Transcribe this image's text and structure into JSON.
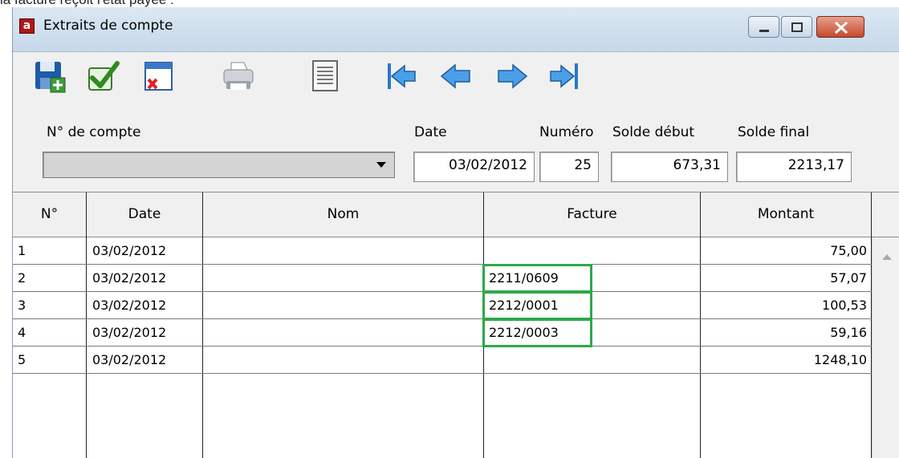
{
  "caption": "la facture reçoit l'état payée :",
  "window": {
    "title": "Extraits de compte",
    "app_icon_letter": "a",
    "accent": "#2fa84a"
  },
  "toolbar": {
    "buttons": [
      {
        "name": "save-new-icon"
      },
      {
        "name": "validate-check-icon"
      },
      {
        "name": "delete-window-icon"
      },
      {
        "name": "printer-icon"
      },
      {
        "name": "document-list-icon"
      },
      {
        "name": "first-record-icon"
      },
      {
        "name": "previous-record-icon"
      },
      {
        "name": "next-record-icon"
      },
      {
        "name": "last-record-icon"
      }
    ]
  },
  "form": {
    "account_label": "N° de compte",
    "account_value": "",
    "date_label": "Date",
    "date_value": "03/02/2012",
    "number_label": "Numéro",
    "number_value": "25",
    "start_balance_label": "Solde début",
    "start_balance_value": "673,31",
    "final_balance_label": "Solde final",
    "final_balance_value": "2213,17"
  },
  "table": {
    "columns": [
      "N°",
      "Date",
      "Nom",
      "Facture",
      "Montant"
    ],
    "rows": [
      {
        "n": "1",
        "date": "03/02/2012",
        "nom": "",
        "facture": "",
        "montant": "75,00"
      },
      {
        "n": "2",
        "date": "03/02/2012",
        "nom": "",
        "facture": "2211/0609",
        "montant": "57,07"
      },
      {
        "n": "3",
        "date": "03/02/2012",
        "nom": "",
        "facture": "2212/0001",
        "montant": "100,53"
      },
      {
        "n": "4",
        "date": "03/02/2012",
        "nom": "",
        "facture": "2212/0003",
        "montant": "59,16"
      },
      {
        "n": "5",
        "date": "03/02/2012",
        "nom": "",
        "facture": "",
        "montant": "1248,10"
      }
    ]
  }
}
